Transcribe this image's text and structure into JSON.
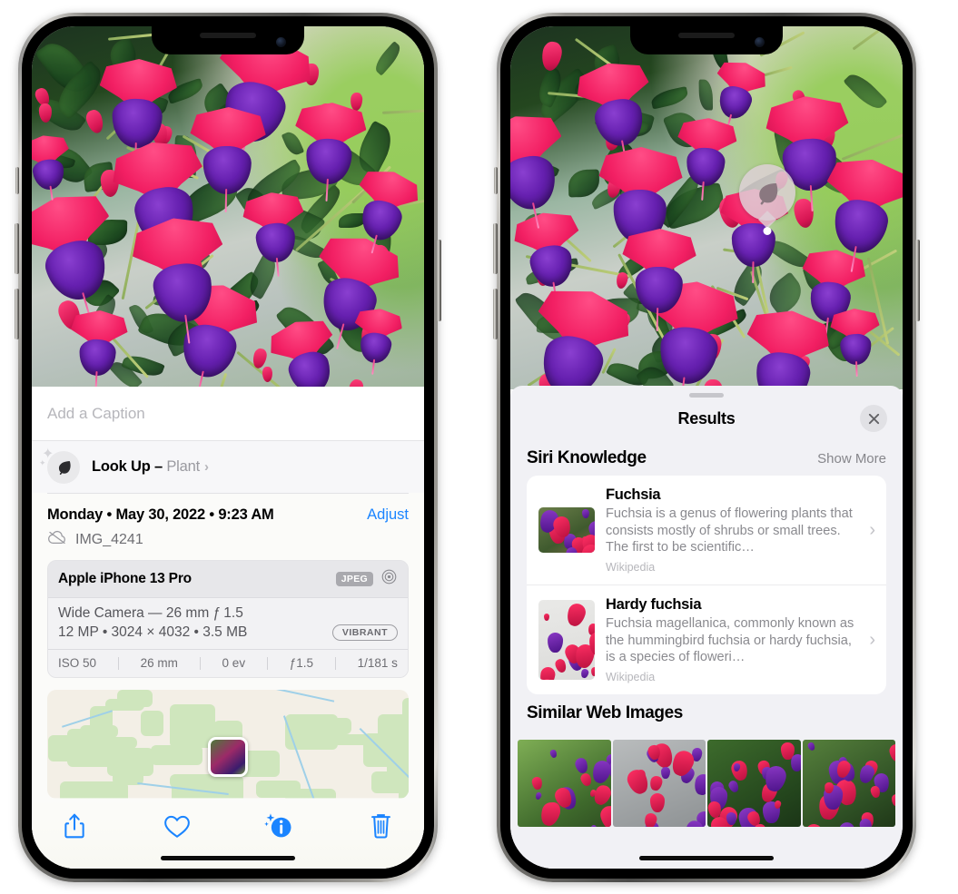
{
  "left_phone": {
    "name": "iphone-photos-info-screen",
    "photo": {
      "alt": "fuchsia-flowers-hanging-basket"
    },
    "caption": {
      "placeholder": "Add a Caption",
      "value": ""
    },
    "lookup": {
      "icon": "leaf-icon",
      "label": "Look Up – ",
      "subject": "Plant",
      "chevron": "›"
    },
    "meta": {
      "date": "Monday • May 30, 2022 • 9:23 AM",
      "adjust_label": "Adjust",
      "cloud_icon": "cloud-slash-icon",
      "filename": "IMG_4241"
    },
    "camera_card": {
      "model": "Apple iPhone 13 Pro",
      "format_badge": "JPEG",
      "aperture_icon": "aperture-icon",
      "lens_line": "Wide Camera — 26 mm ƒ 1.5",
      "size_line": "12 MP • 3024 × 4032 • 3.5 MB",
      "style_badge": "VIBRANT",
      "exif": [
        "ISO 50",
        "26 mm",
        "0 ev",
        "ƒ1.5",
        "1/181 s"
      ]
    },
    "map": {
      "alt": "location-map-thumbnail",
      "pin": "photo-pin"
    },
    "toolbar": [
      {
        "name": "share-button",
        "icon": "share-icon"
      },
      {
        "name": "favorite-button",
        "icon": "heart-icon"
      },
      {
        "name": "info-button",
        "icon": "info-sparkle-icon"
      },
      {
        "name": "delete-button",
        "icon": "trash-icon"
      }
    ],
    "colors": {
      "accent": "#1a84ff",
      "panel": "#fbfbf9"
    }
  },
  "right_phone": {
    "name": "iphone-visual-lookup-results",
    "badge": {
      "icon": "leaf-icon",
      "label": "plant-lookup-badge"
    },
    "sheet": {
      "grabber": "sheet-grabber",
      "title": "Results",
      "close_icon": "close-icon"
    },
    "siri_knowledge": {
      "title": "Siri Knowledge",
      "action": "Show More",
      "items": [
        {
          "title": "Fuchsia",
          "description": "Fuchsia is a genus of flowering plants that consists mostly of shrubs or small trees. The first to be scientific…",
          "source": "Wikipedia",
          "thumb": "fuchsia-red-flowers-thumb",
          "chevron": "›"
        },
        {
          "title": "Hardy fuchsia",
          "description": "Fuchsia magellanica, commonly known as the hummingbird fuchsia or hardy fuchsia, is a species of floweri…",
          "source": "Wikipedia",
          "thumb": "hardy-fuchsia-branch-thumb",
          "chevron": "›"
        }
      ]
    },
    "similar_web_images": {
      "title": "Similar Web Images",
      "items": [
        {
          "alt": "fuchsia-web-image-1"
        },
        {
          "alt": "fuchsia-web-image-2"
        },
        {
          "alt": "fuchsia-web-image-3"
        },
        {
          "alt": "fuchsia-web-image-4"
        }
      ]
    },
    "colors": {
      "sheet_bg": "#f1f1f5",
      "card_bg": "#ffffff"
    }
  }
}
